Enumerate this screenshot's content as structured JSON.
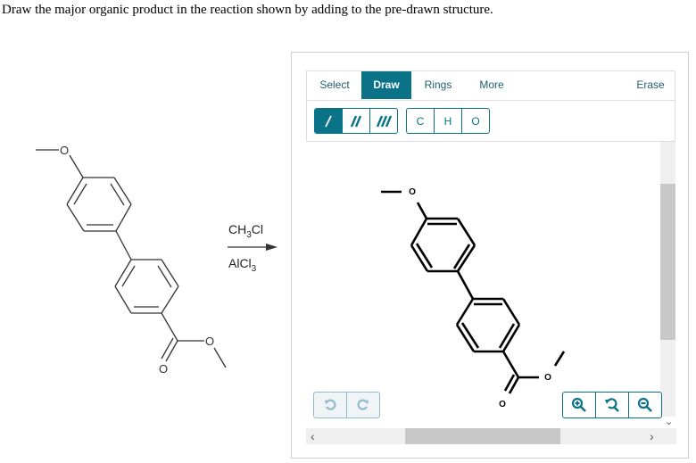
{
  "question": "Draw the major organic product in the reaction shown by adding to the pre-drawn structure.",
  "reaction": {
    "reagent_top": {
      "main": "CH",
      "sub": "3",
      "tail": "Cl"
    },
    "reagent_bottom": {
      "main": "AlCl",
      "sub": "3"
    },
    "reactant_atoms": {
      "O1": "O",
      "O2": "O",
      "O3": "O"
    }
  },
  "editor": {
    "tabs": [
      {
        "label": "Select",
        "active": false
      },
      {
        "label": "Draw",
        "active": true
      },
      {
        "label": "Rings",
        "active": false
      },
      {
        "label": "More",
        "active": false
      }
    ],
    "erase_label": "Erase",
    "bond_buttons": [
      {
        "icon": "single-bond-icon",
        "active": true
      },
      {
        "icon": "double-bond-icon",
        "active": false
      },
      {
        "icon": "triple-bond-icon",
        "active": false
      }
    ],
    "atom_buttons": [
      "C",
      "H",
      "O"
    ],
    "canvas_atoms": {
      "O1": "O",
      "O2": "O",
      "O3": "O"
    },
    "undo_icon": "undo-icon",
    "redo_icon": "redo-icon",
    "zoom_buttons": [
      "zoom-in-icon",
      "reset-zoom-icon",
      "zoom-out-icon"
    ],
    "scroll_left": "‹",
    "scroll_right": "›",
    "scroll_down": "⌄"
  }
}
